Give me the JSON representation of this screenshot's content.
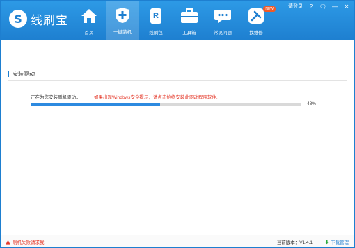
{
  "app": {
    "logo_glyph": "S",
    "name": "线刷宝"
  },
  "nav": [
    {
      "label": "首页",
      "icon": "home-icon"
    },
    {
      "label": "一键装机",
      "icon": "shield-plus-icon",
      "active": true
    },
    {
      "label": "线刷包",
      "icon": "rom-package-icon"
    },
    {
      "label": "工具箱",
      "icon": "toolbox-icon"
    },
    {
      "label": "常见问题",
      "icon": "chat-bubble-icon"
    },
    {
      "label": "找维修",
      "icon": "wrench-icon",
      "badge": "NEW"
    }
  ],
  "titlebar": {
    "login": "请登录",
    "help": "?",
    "feedback": "🗨",
    "minimize": "—",
    "close": "✕"
  },
  "section": {
    "title": "安装驱动"
  },
  "install": {
    "status": "正在为您安装刷机驱动...",
    "warning": "如果出现Windows安全提示，请点击始终安装此驱动程序软件.",
    "progress": 0.48,
    "progress_text": "48%"
  },
  "footer": {
    "feedback": "刷机失败请求我",
    "version": "当前版本：V1.4.1",
    "download": "下载管理"
  },
  "colors": {
    "brand": "#1e7fd0",
    "warning": "#e53b2c",
    "progress": "#2d8ae0"
  }
}
